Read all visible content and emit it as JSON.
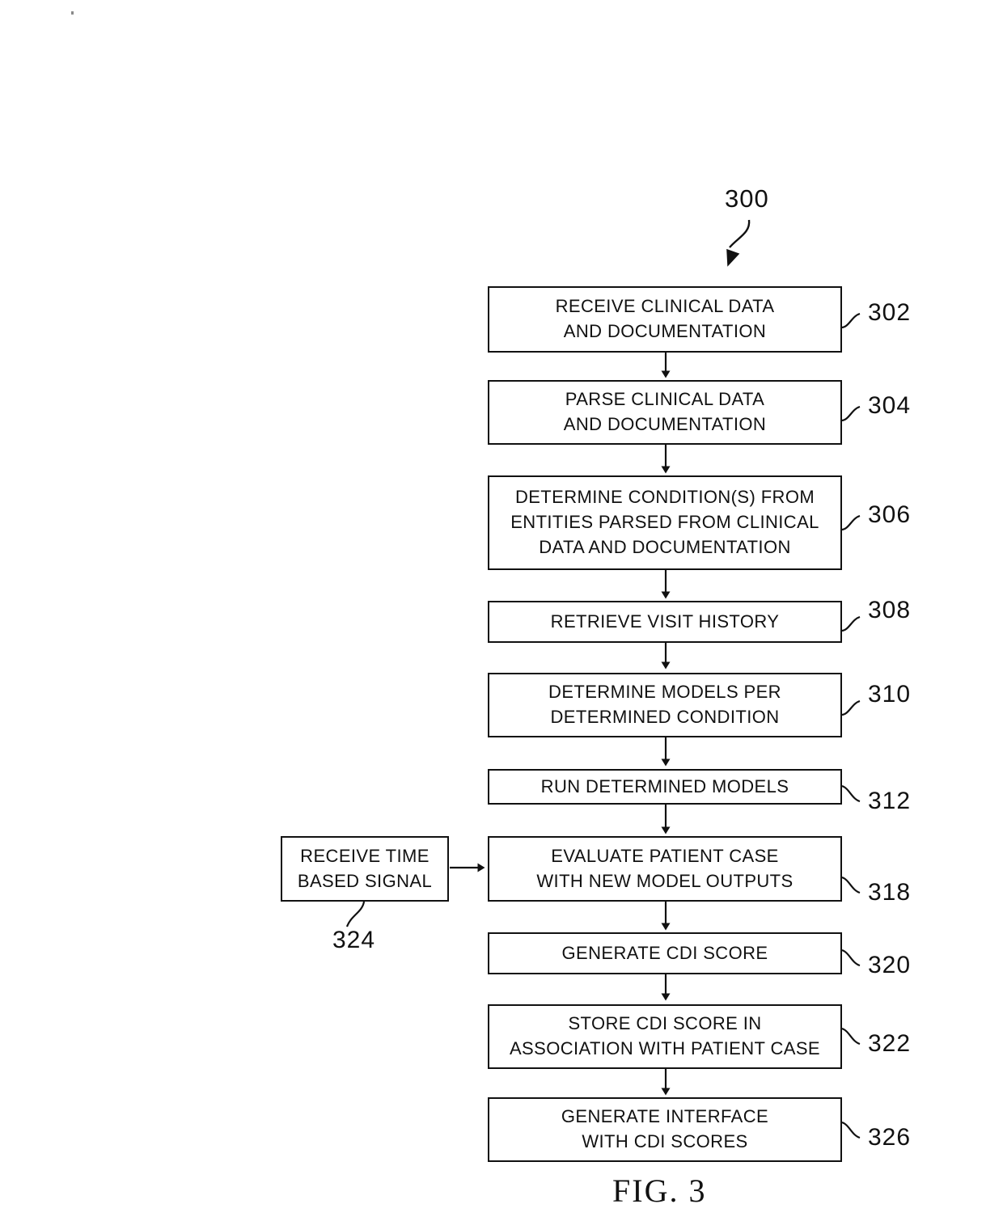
{
  "figure": {
    "caption": "FIG. 3",
    "flow_label": "300"
  },
  "boxes": [
    {
      "id": "302",
      "ref": "302",
      "lines": [
        "RECEIVE CLINICAL DATA",
        "AND DOCUMENTATION"
      ],
      "name": "step-receive-clinical-data"
    },
    {
      "id": "304",
      "ref": "304",
      "lines": [
        "PARSE CLINICAL DATA",
        "AND DOCUMENTATION"
      ],
      "name": "step-parse-clinical-data"
    },
    {
      "id": "306",
      "ref": "306",
      "lines": [
        "DETERMINE CONDITION(S) FROM",
        "ENTITIES PARSED FROM CLINICAL",
        "DATA AND DOCUMENTATION"
      ],
      "name": "step-determine-conditions"
    },
    {
      "id": "308",
      "ref": "308",
      "lines": [
        "RETRIEVE VISIT HISTORY"
      ],
      "name": "step-retrieve-visit-history"
    },
    {
      "id": "310",
      "ref": "310",
      "lines": [
        "DETERMINE MODELS PER",
        "DETERMINED CONDITION"
      ],
      "name": "step-determine-models"
    },
    {
      "id": "312",
      "ref": "312",
      "lines": [
        "RUN DETERMINED MODELS"
      ],
      "name": "step-run-determined-models"
    },
    {
      "id": "318",
      "ref": "318",
      "lines": [
        "EVALUATE PATIENT CASE",
        "WITH NEW MODEL OUTPUTS"
      ],
      "name": "step-evaluate-patient-case"
    },
    {
      "id": "320",
      "ref": "320",
      "lines": [
        "GENERATE CDI SCORE"
      ],
      "name": "step-generate-cdi-score"
    },
    {
      "id": "322",
      "ref": "322",
      "lines": [
        "STORE CDI SCORE IN",
        "ASSOCIATION WITH PATIENT CASE"
      ],
      "name": "step-store-cdi-score"
    },
    {
      "id": "326",
      "ref": "326",
      "lines": [
        "GENERATE INTERFACE",
        "WITH CDI SCORES"
      ],
      "name": "step-generate-interface"
    },
    {
      "id": "324",
      "ref": "324",
      "lines": [
        "RECEIVE TIME",
        "BASED SIGNAL"
      ],
      "name": "step-receive-time-based-signal"
    }
  ],
  "chart_data": {
    "type": "diagram",
    "title": "FIG. 3",
    "diagram_kind": "flowchart",
    "flow_reference": "300",
    "orientation": "top-to-bottom",
    "nodes": [
      {
        "ref": "302",
        "text": "RECEIVE CLINICAL DATA AND DOCUMENTATION"
      },
      {
        "ref": "304",
        "text": "PARSE CLINICAL DATA AND DOCUMENTATION"
      },
      {
        "ref": "306",
        "text": "DETERMINE CONDITION(S) FROM ENTITIES PARSED FROM CLINICAL DATA AND DOCUMENTATION"
      },
      {
        "ref": "308",
        "text": "RETRIEVE VISIT HISTORY"
      },
      {
        "ref": "310",
        "text": "DETERMINE MODELS PER DETERMINED CONDITION"
      },
      {
        "ref": "312",
        "text": "RUN DETERMINED MODELS"
      },
      {
        "ref": "318",
        "text": "EVALUATE PATIENT CASE WITH NEW MODEL OUTPUTS"
      },
      {
        "ref": "320",
        "text": "GENERATE CDI SCORE"
      },
      {
        "ref": "322",
        "text": "STORE CDI SCORE IN ASSOCIATION WITH PATIENT CASE"
      },
      {
        "ref": "326",
        "text": "GENERATE INTERFACE WITH CDI SCORES"
      },
      {
        "ref": "324",
        "text": "RECEIVE TIME BASED SIGNAL"
      }
    ],
    "edges": [
      {
        "from": "302",
        "to": "304"
      },
      {
        "from": "304",
        "to": "306"
      },
      {
        "from": "306",
        "to": "308"
      },
      {
        "from": "308",
        "to": "310"
      },
      {
        "from": "310",
        "to": "312"
      },
      {
        "from": "312",
        "to": "318"
      },
      {
        "from": "324",
        "to": "318"
      },
      {
        "from": "318",
        "to": "320"
      },
      {
        "from": "320",
        "to": "322"
      },
      {
        "from": "322",
        "to": "326"
      }
    ]
  }
}
